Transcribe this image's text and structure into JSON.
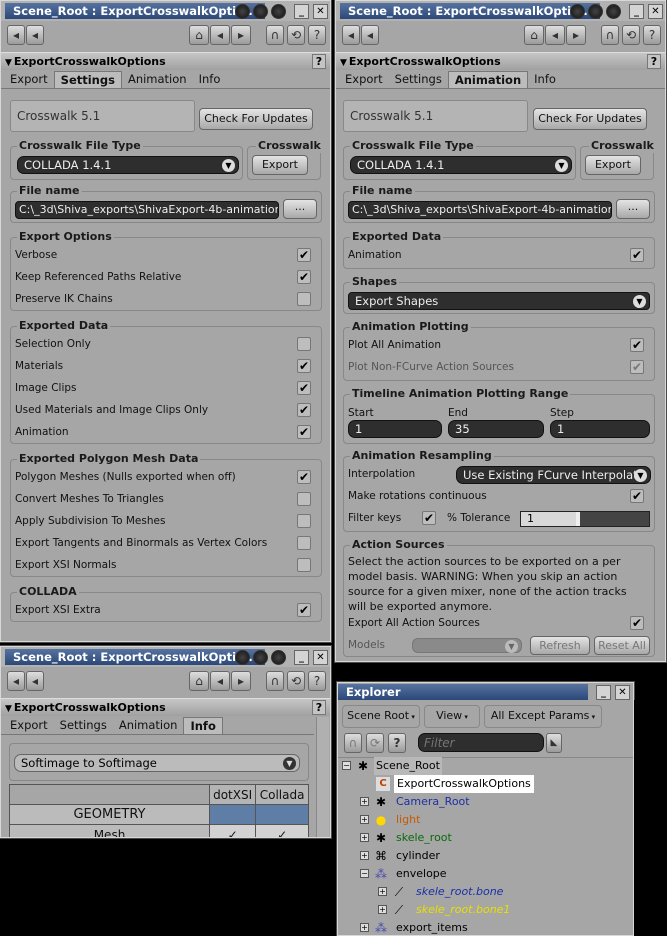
{
  "w1": {
    "title": "Scene_Root : ExportCrosswalkOptio...",
    "panel": "ExportCrosswalkOptions",
    "tabs": [
      "Export",
      "Settings",
      "Animation",
      "Info"
    ],
    "crosswalk": "Crosswalk 5.1",
    "check": "Check For Updates",
    "filetype_label": "Crosswalk File Type",
    "filetype": "COLLADA 1.4.1",
    "cw_label": "Crosswalk",
    "export_btn": "Export",
    "filename_label": "File name",
    "filename": "C:\\_3d\\Shiva_exports\\ShivaExport-4b-animation",
    "opts_label": "Export Options",
    "opts": [
      {
        "l": "Verbose",
        "c": "✔"
      },
      {
        "l": "Keep Referenced Paths Relative",
        "c": "✔"
      },
      {
        "l": "Preserve IK Chains",
        "c": ""
      }
    ],
    "data_label": "Exported Data",
    "data": [
      {
        "l": "Selection Only",
        "c": ""
      },
      {
        "l": "Materials",
        "c": "✔"
      },
      {
        "l": "Image Clips",
        "c": "✔"
      },
      {
        "l": "Used Materials and Image Clips Only",
        "c": "✔"
      },
      {
        "l": "Animation",
        "c": "✔"
      }
    ],
    "poly_label": "Exported Polygon Mesh Data",
    "poly": [
      {
        "l": "Polygon Meshes (Nulls exported when off)",
        "c": "✔"
      },
      {
        "l": "Convert Meshes To Triangles",
        "c": ""
      },
      {
        "l": "Apply Subdivision To Meshes",
        "c": ""
      },
      {
        "l": "Export Tangents and Binormals as Vertex Colors",
        "c": ""
      },
      {
        "l": "Export XSI Normals",
        "c": ""
      }
    ],
    "collada_label": "COLLADA",
    "collada": [
      {
        "l": "Export XSI Extra",
        "c": "✔"
      }
    ]
  },
  "w2": {
    "title": "Scene_Root : ExportCrosswalkOptio...",
    "panel": "ExportCrosswalkOptions",
    "data_label": "Exported Data",
    "anim": "Animation",
    "shapes_label": "Shapes",
    "shapes": "Export Shapes",
    "plot_label": "Animation Plotting",
    "plot_all": "Plot All Animation",
    "plot_non": "Plot Non-FCurve Action Sources",
    "range_label": "Timeline Animation Plotting Range",
    "start_l": "Start",
    "end_l": "End",
    "step_l": "Step",
    "start": "1",
    "end": "35",
    "step": "1",
    "resamp_label": "Animation Resampling",
    "interp_l": "Interpolation",
    "interp": "Use Existing FCurve Interpolat",
    "rot": "Make rotations continuous",
    "filter": "Filter keys",
    "tol": "% Tolerance",
    "tolv": "1",
    "as_label": "Action Sources",
    "as_text": "Select the action sources to be exported on a per model basis. WARNING: When you skip an action source for a given mixer, none of the action tracks will be exported anymore.",
    "exp_all": "Export All Action Sources",
    "models": "Models",
    "refresh": "Refresh",
    "reset": "Reset All"
  },
  "w3": {
    "title": "Scene_Root : ExportCrosswalkOptio...",
    "panel": "ExportCrosswalkOptions",
    "mode": "Softimage to Softimage",
    "h1": "dotXSI",
    "h2": "Collada",
    "geom": "GEOMETRY",
    "mesh": "Mesh",
    "ck": "✓"
  },
  "explorer": {
    "title": "Explorer",
    "scene_btn": "Scene Root",
    "view_btn": "View",
    "params_btn": "All Except Params",
    "filter_ph": "Filter",
    "nodes": [
      {
        "t": "Scene_Root",
        "c": "#000"
      },
      {
        "t": "ExportCrosswalkOptions",
        "c": "#000"
      },
      {
        "t": "Camera_Root",
        "c": "#1a2fa8"
      },
      {
        "t": "light",
        "c": "#c85a00"
      },
      {
        "t": "skele_root",
        "c": "#0a6a0a"
      },
      {
        "t": "cylinder",
        "c": "#000"
      },
      {
        "t": "envelope",
        "c": "#000"
      },
      {
        "t": "skele_root.bone",
        "c": "#1a2fa8"
      },
      {
        "t": "skele_root.bone1",
        "c": "#e8e000"
      },
      {
        "t": "export_items",
        "c": "#000"
      }
    ]
  }
}
